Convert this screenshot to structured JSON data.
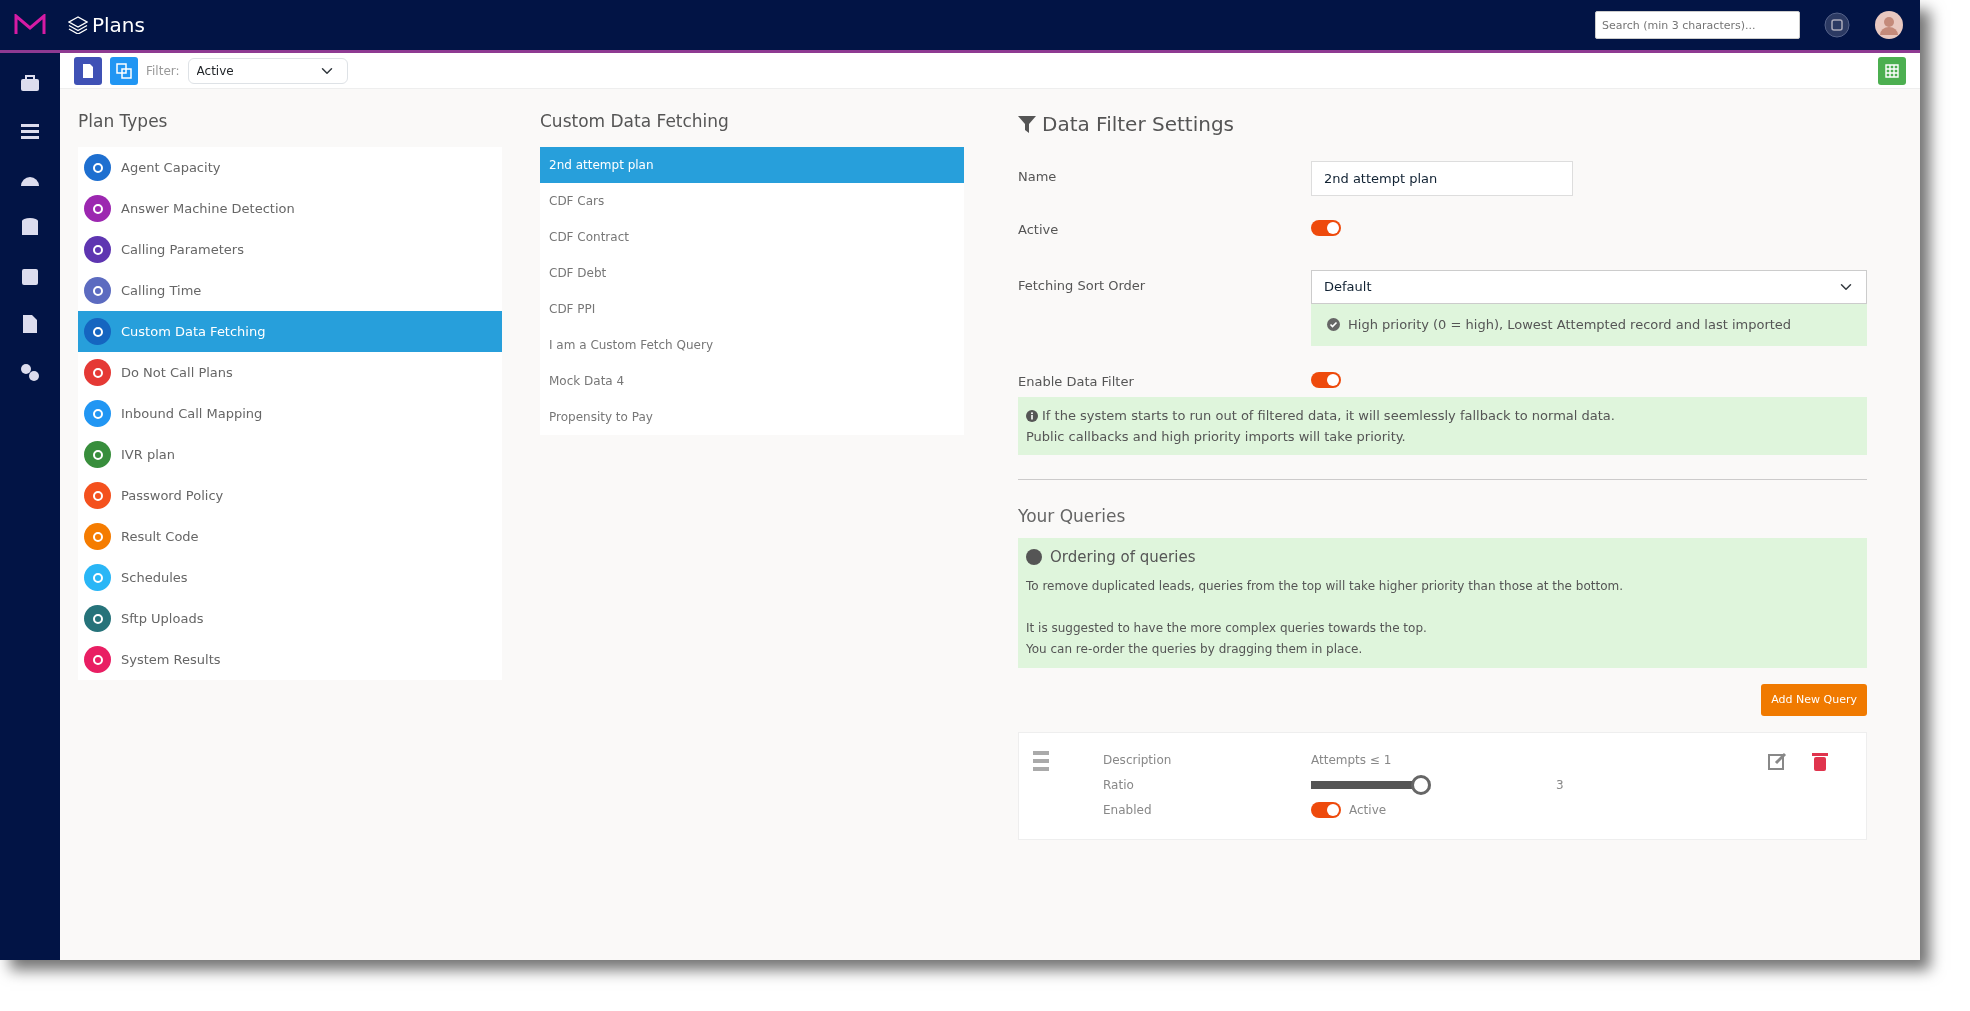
{
  "app": {
    "title": "Plans"
  },
  "search": {
    "placeholder": "Search (min 3 characters)..."
  },
  "toolbar": {
    "filter_label": "Filter:",
    "filter_value": "Active"
  },
  "plan_types": {
    "title": "Plan Types",
    "items": [
      {
        "label": "Agent Capacity",
        "color": "#1e6fd0",
        "selected": false
      },
      {
        "label": "Answer Machine Detection",
        "color": "#9c27b0",
        "selected": false
      },
      {
        "label": "Calling Parameters",
        "color": "#5e35b1",
        "selected": false
      },
      {
        "label": "Calling Time",
        "color": "#5c6bc0",
        "selected": false
      },
      {
        "label": "Custom Data Fetching",
        "color": "#1565c0",
        "selected": true
      },
      {
        "label": "Do Not Call Plans",
        "color": "#e53935",
        "selected": false
      },
      {
        "label": "Inbound Call Mapping",
        "color": "#2196f3",
        "selected": false
      },
      {
        "label": "IVR plan",
        "color": "#388e3c",
        "selected": false
      },
      {
        "label": "Password Policy",
        "color": "#f4511e",
        "selected": false
      },
      {
        "label": "Result Code",
        "color": "#f57c00",
        "selected": false
      },
      {
        "label": "Schedules",
        "color": "#29b6f6",
        "selected": false
      },
      {
        "label": "Sftp Uploads",
        "color": "#26737a",
        "selected": false
      },
      {
        "label": "System Results",
        "color": "#e91e63",
        "selected": false
      }
    ]
  },
  "plans": {
    "title": "Custom Data Fetching",
    "items": [
      {
        "label": "2nd attempt plan",
        "selected": true
      },
      {
        "label": "CDF Cars",
        "selected": false
      },
      {
        "label": "CDF Contract",
        "selected": false
      },
      {
        "label": "CDF Debt",
        "selected": false
      },
      {
        "label": "CDF PPI",
        "selected": false
      },
      {
        "label": "I am a Custom Fetch Query",
        "selected": false
      },
      {
        "label": "Mock Data 4",
        "selected": false
      },
      {
        "label": "Propensity to Pay",
        "selected": false
      }
    ]
  },
  "settings": {
    "title": "Data Filter Settings",
    "name_label": "Name",
    "name_value": "2nd attempt plan",
    "active_label": "Active",
    "active_on": true,
    "sort_label": "Fetching Sort Order",
    "sort_value": "Default",
    "sort_note": "High priority (0 = high), Lowest Attempted record and last imported",
    "filter_label": "Enable Data Filter",
    "filter_on": true,
    "filter_note_lines": [
      "If the system starts to run out of filtered data, it will seemlessly fallback to normal data.",
      "Public callbacks and high priority imports will take priority."
    ]
  },
  "queries": {
    "title": "Your Queries",
    "info_title": "Ordering of queries",
    "info_paragraphs": [
      {
        "lines": [
          "To remove duplicated leads, queries from the top will take higher priority than those at the bottom."
        ]
      },
      {
        "lines": [
          "It is suggested to have the more complex queries towards the top.",
          "You can re-order the queries by dragging them in place."
        ]
      }
    ],
    "add_button": "Add New Query",
    "items": [
      {
        "description_label": "Description",
        "description": "Attempts ≤ 1",
        "ratio_label": "Ratio",
        "level": 1,
        "ratio_value": "3",
        "enabled_label": "Enabled",
        "enabled_on": true,
        "enabled_text": "Active"
      }
    ]
  }
}
